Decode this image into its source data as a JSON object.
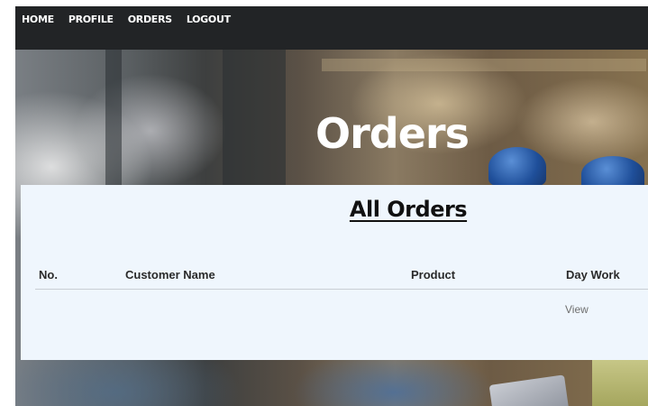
{
  "nav": {
    "items": [
      {
        "label": "HOME"
      },
      {
        "label": "PROFILE"
      },
      {
        "label": "ORDERS"
      },
      {
        "label": "LOGOUT"
      }
    ]
  },
  "hero": {
    "title": "Orders"
  },
  "orders_section": {
    "heading": "All Orders",
    "table": {
      "columns": [
        "No.",
        "Customer Name",
        "Product",
        "Day Work"
      ],
      "rows": [
        {
          "action_label": "View"
        }
      ]
    }
  },
  "colors": {
    "navbar_bg": "#222426",
    "card_bg": "#eff6fd",
    "text_dark": "#111111",
    "link_gray": "#6e6e6e"
  }
}
